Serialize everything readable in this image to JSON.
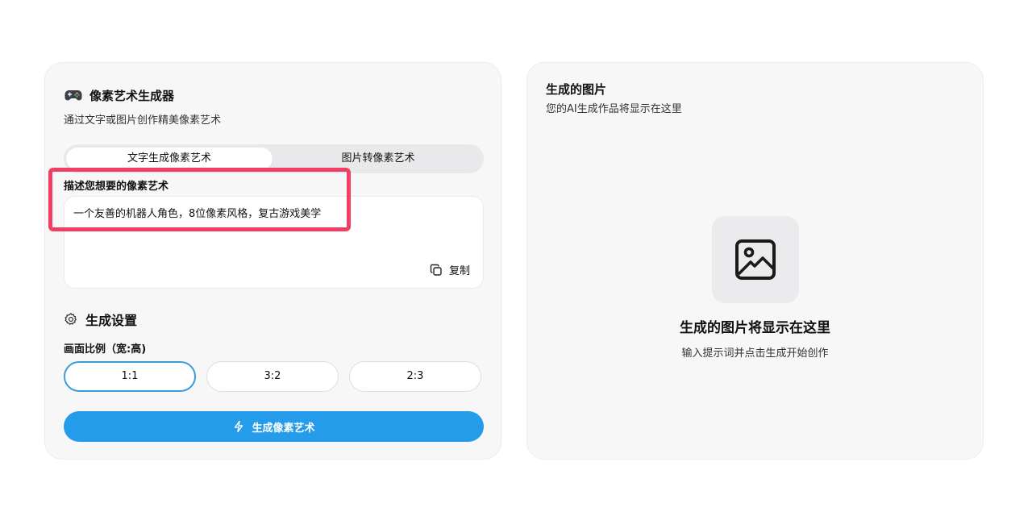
{
  "generator": {
    "icon": "gamepad-icon",
    "title": "像素艺术生成器",
    "subtitle": "通过文字或图片创作精美像素艺术",
    "tabs": [
      {
        "label": "文字生成像素艺术",
        "active": true
      },
      {
        "label": "图片转像素艺术",
        "active": false
      }
    ],
    "prompt": {
      "label": "描述您想要的像素艺术",
      "value": "一个友善的机器人角色，8位像素风格，复古游戏美学",
      "copy_label": "复制"
    },
    "settings": {
      "title": "生成设置",
      "ratio_label": "画面比例（宽:高)",
      "ratios": [
        "1:1",
        "3:2",
        "2:3"
      ],
      "selected_ratio": "1:1"
    },
    "generate_label": "生成像素艺术",
    "colors": {
      "accent": "#249ce9",
      "highlight": "#f23e63"
    }
  },
  "output": {
    "title": "生成的图片",
    "subtitle": "您的AI生成作品将显示在这里",
    "empty_icon": "image-icon",
    "empty_title": "生成的图片将显示在这里",
    "empty_desc": "输入提示词并点击生成开始创作"
  }
}
